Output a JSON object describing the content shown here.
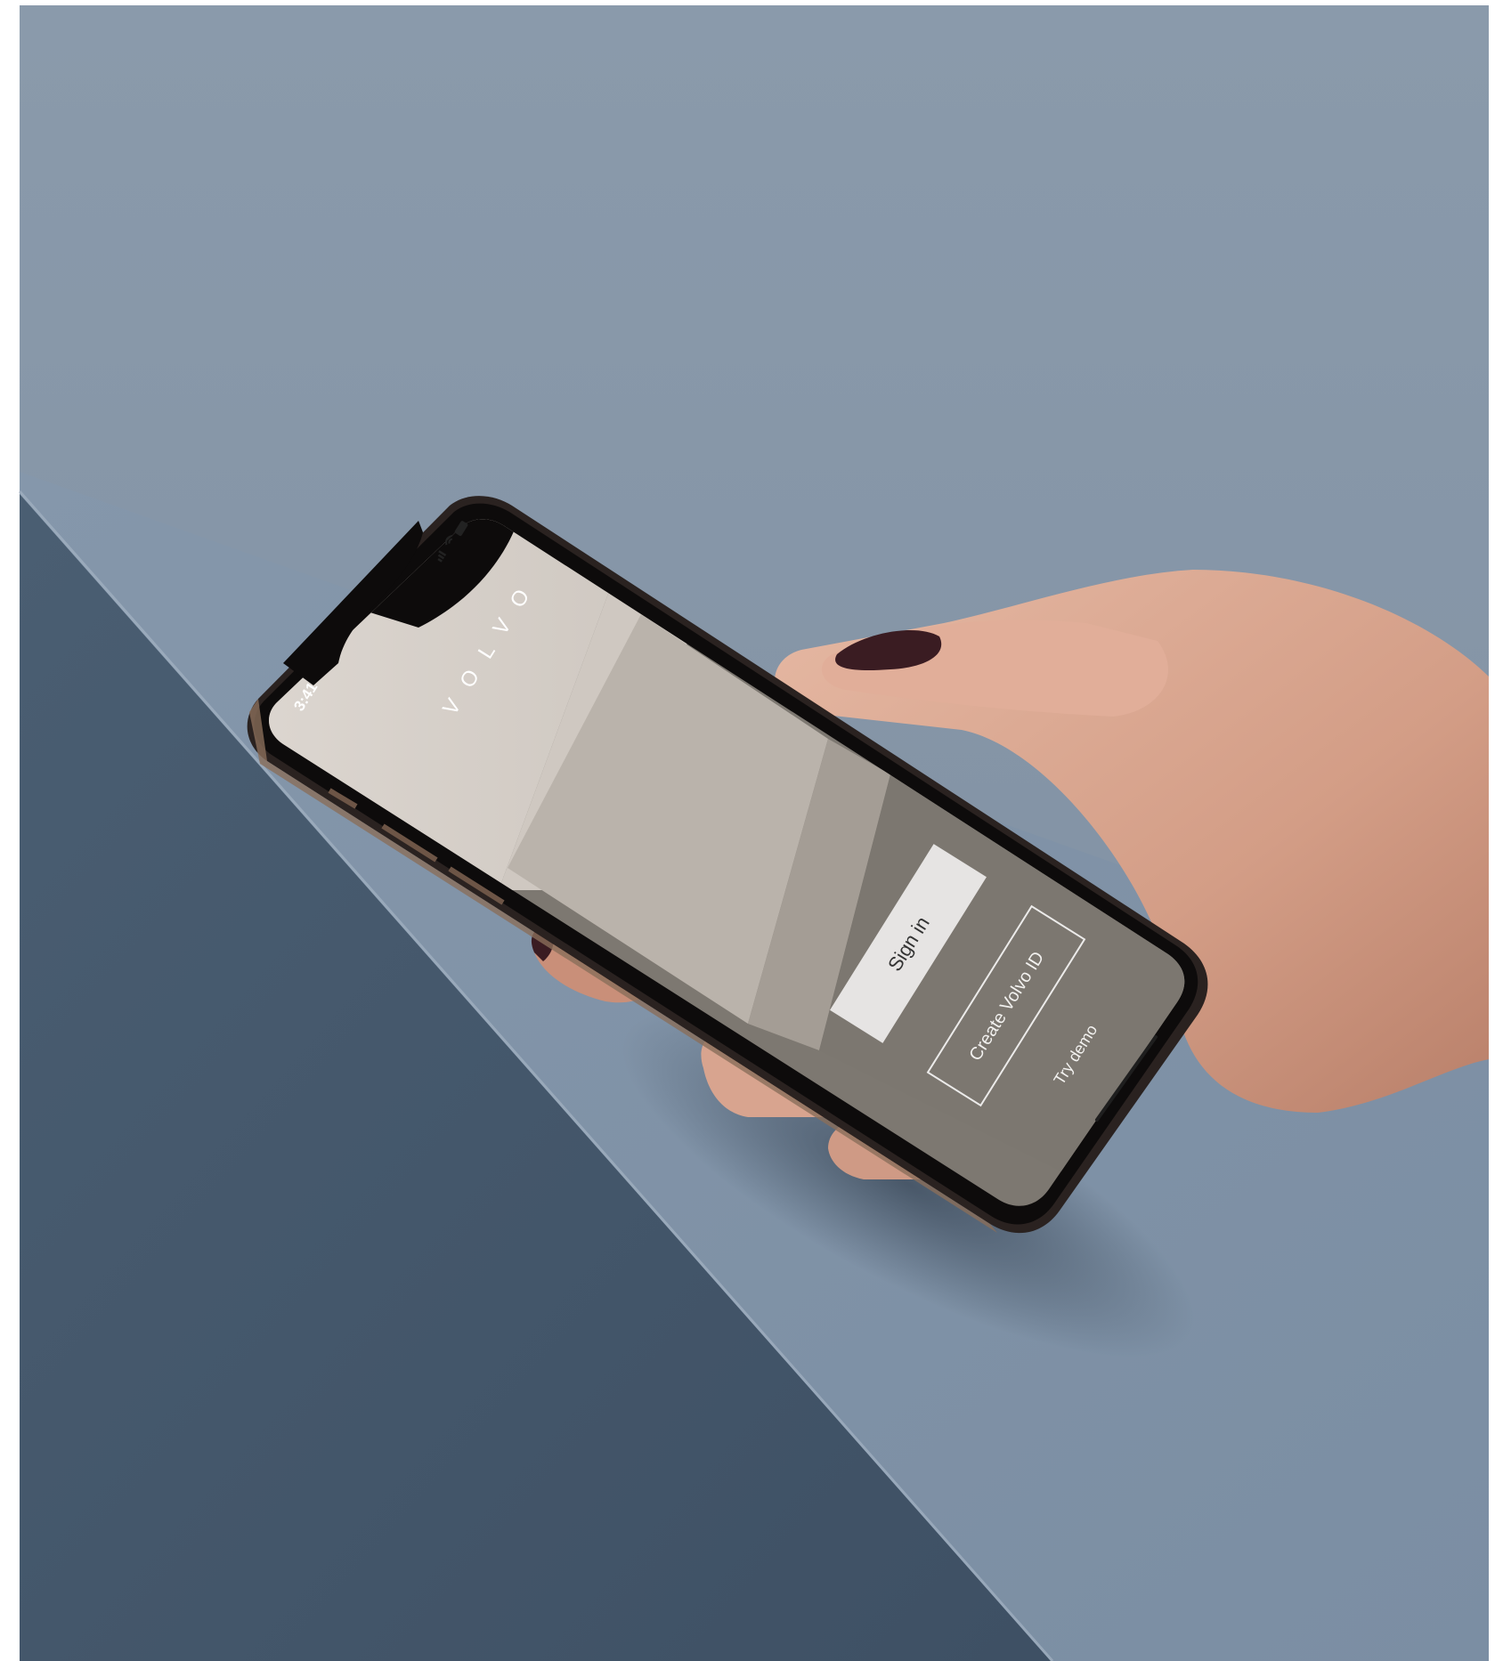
{
  "phone_screen": {
    "status_time": "3:41",
    "brand_wordmark": "VOLVO",
    "sign_in_label": "Sign in",
    "create_id_label": "Create Volvo ID",
    "try_demo_label": "Try demo"
  },
  "colors": {
    "wall": "#8796a8",
    "desk_top": "#7f91a6",
    "desk_front": "#465a6e",
    "screen_light": "#d8d2cc",
    "screen_mid": "#bdb6ae",
    "screen_dark": "#7c7770",
    "phone_frame": "#1a1716",
    "skin": "#d9a892",
    "nail": "#3a1c22"
  },
  "icons": [
    "signal-icon",
    "wifi-icon",
    "battery-icon"
  ]
}
